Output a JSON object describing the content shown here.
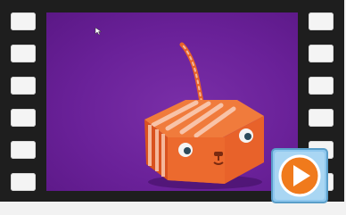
{
  "thumbnail": {
    "colors": {
      "background": "#6a2199",
      "film": "#1e1e1e",
      "sprocket": "#f4f4f4",
      "creature": "#e8622a",
      "stripe": "#f5b79a",
      "badge_frame": "#8fc8ee",
      "badge_circle": "#f07a1c"
    },
    "icons": {
      "pointer": "cursor-icon",
      "play": "play-icon"
    }
  }
}
